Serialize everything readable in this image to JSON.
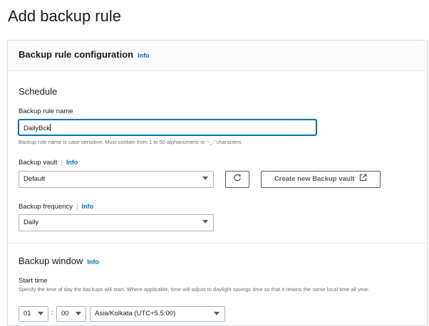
{
  "page": {
    "title": "Add backup rule"
  },
  "card": {
    "title": "Backup rule configuration",
    "info": "Info"
  },
  "schedule": {
    "title": "Schedule",
    "rule_name": {
      "label": "Backup rule name",
      "value": "DailyBck",
      "hint": "Backup rule name is case sensitive. Must contain from 1 to 50 alphanumeric or '-_.' characters."
    },
    "vault": {
      "label": "Backup vault",
      "info": "Info",
      "selected": "Default",
      "refresh_icon": "refresh-icon",
      "create_label": "Create new Backup vault",
      "external_icon": "external-link-icon"
    },
    "frequency": {
      "label": "Backup frequency",
      "info": "Info",
      "selected": "Daily"
    }
  },
  "window": {
    "title": "Backup window",
    "info": "Info",
    "start_time": {
      "label": "Start time",
      "description": "Specify the time of day the backups will start. Where applicable, time will adjust to daylight savings time so that it retains the same local time all year.",
      "hour": "01",
      "separator": ":",
      "minute": "00",
      "timezone": "Asia/Kolkata (UTC+5.5:00)"
    }
  },
  "colors": {
    "link": "#0073bb",
    "focus": "#0073bb",
    "text": "#16191f"
  }
}
